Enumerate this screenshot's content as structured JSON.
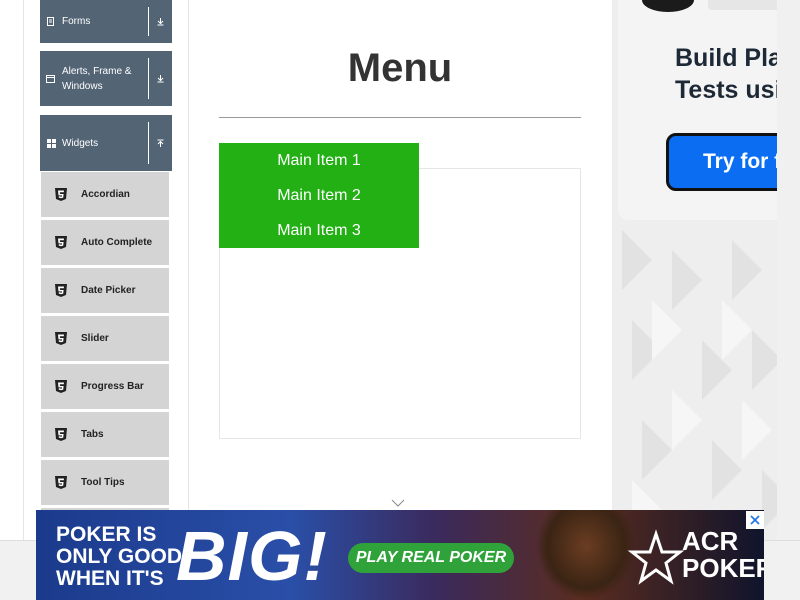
{
  "sidebar": {
    "groups": [
      {
        "label": "Forms",
        "icon": "file-icon",
        "toggle_icon": "download-arrow-icon"
      },
      {
        "label": "Alerts, Frame & Windows",
        "icon": "window-icon",
        "toggle_icon": "download-arrow-icon"
      },
      {
        "label": "Widgets",
        "icon": "grid-icon",
        "toggle_icon": "upload-arrow-icon"
      }
    ],
    "items": [
      {
        "label": "Accordian",
        "icon": "html5-icon"
      },
      {
        "label": "Auto Complete",
        "icon": "html5-icon"
      },
      {
        "label": "Date Picker",
        "icon": "html5-icon"
      },
      {
        "label": "Slider",
        "icon": "html5-icon"
      },
      {
        "label": "Progress Bar",
        "icon": "html5-icon"
      },
      {
        "label": "Tabs",
        "icon": "html5-icon"
      },
      {
        "label": "Tool Tips",
        "icon": "html5-icon"
      }
    ]
  },
  "main": {
    "title": "Menu",
    "menu_items": [
      "Main Item 1",
      "Main Item 2",
      "Main Item 3"
    ]
  },
  "ad_right": {
    "headline": "Build Playw\nTests usi",
    "cta": "Try for fre"
  },
  "ad_bottom": {
    "tagline": "POKER IS\nONLY GOOD\nWHEN IT'S",
    "big": "BIG!",
    "cta": "PLAY REAL POKER",
    "brand": "ACR\nPOKER",
    "close_icon": "close-icon"
  },
  "colors": {
    "sidebar_group": "#536475",
    "sidebar_item": "#d4d4d4",
    "menu_bg": "#22b014",
    "ad_cta": "#0a6df2"
  }
}
